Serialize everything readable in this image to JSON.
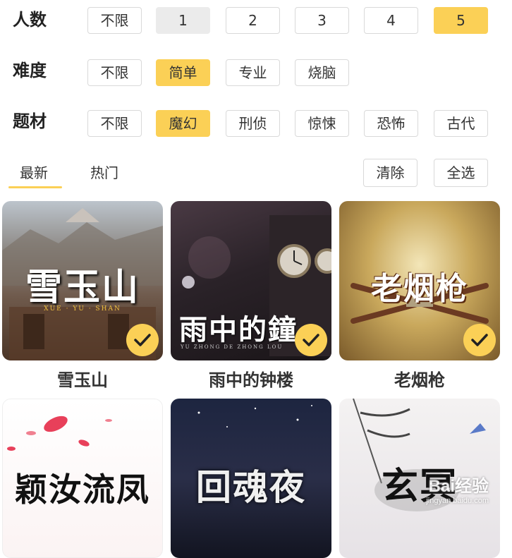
{
  "filters": {
    "players": {
      "label": "人数",
      "options": [
        "不限",
        "1",
        "2",
        "3",
        "4",
        "5"
      ]
    },
    "difficulty": {
      "label": "难度",
      "options": [
        "不限",
        "简单",
        "专业",
        "烧脑"
      ]
    },
    "theme": {
      "label": "题材",
      "options": [
        "不限",
        "魔幻",
        "刑侦",
        "惊悚",
        "恐怖",
        "古代"
      ]
    }
  },
  "sort_tabs": [
    "最新",
    "热门"
  ],
  "actions": {
    "clear": "清除",
    "select_all": "全选"
  },
  "scripts": [
    {
      "name": "雪玉山",
      "cover_title": "雪玉山",
      "cover_sub": "XUE · YU · SHAN",
      "selected": true
    },
    {
      "name": "雨中的钟楼",
      "cover_title": "雨中的鐘",
      "cover_sub": "YU ZHONG DE ZHONG LOU",
      "selected": true
    },
    {
      "name": "老烟枪",
      "cover_title": "老烟枪",
      "cover_sub": "",
      "selected": true
    },
    {
      "name": "",
      "cover_title": "颖汝流凤",
      "cover_sub": "",
      "selected": false
    },
    {
      "name": "",
      "cover_title": "回魂夜",
      "cover_sub": "",
      "selected": false
    },
    {
      "name": "",
      "cover_title": "玄冥",
      "cover_sub": "",
      "selected": false
    }
  ],
  "watermark": {
    "brand": "Bai经验",
    "url": "jingyan.baidu.com"
  },
  "colors": {
    "accent": "#fbd056",
    "chip_border": "#d9d9d9"
  }
}
